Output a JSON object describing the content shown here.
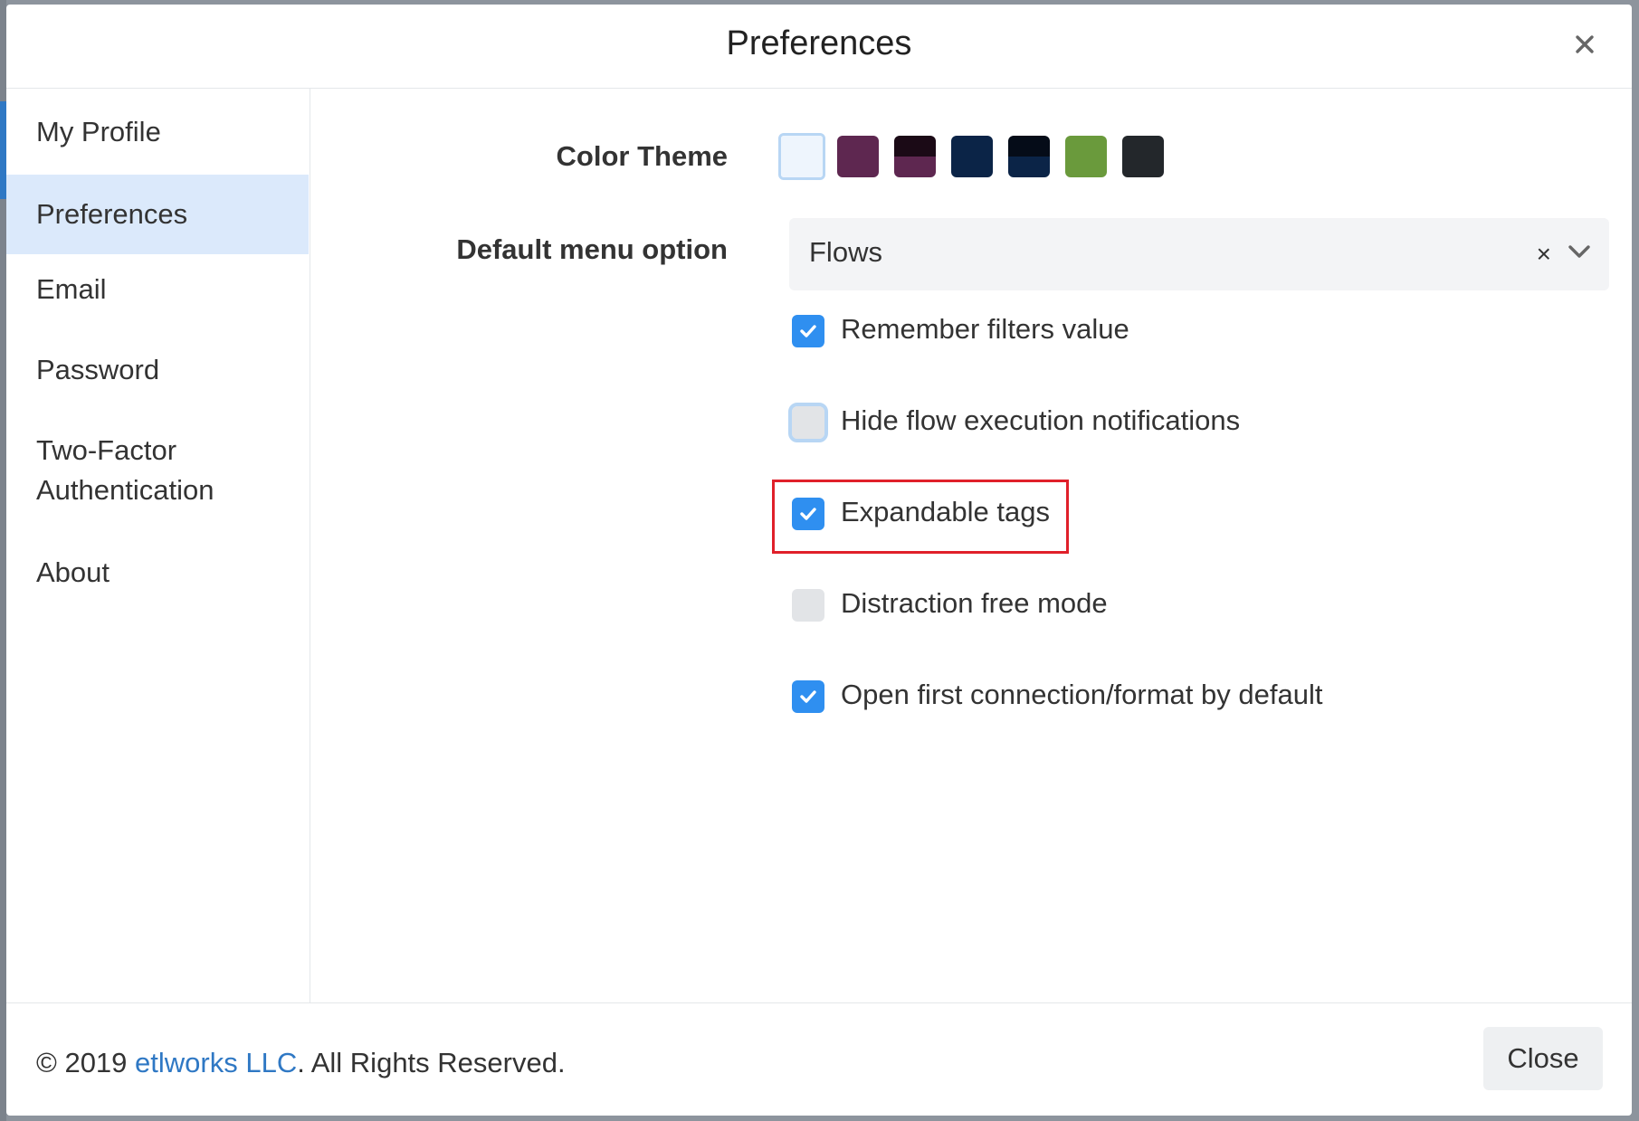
{
  "modal": {
    "title": "Preferences",
    "close_icon": "close-icon"
  },
  "sidebar": {
    "items": [
      {
        "label": "My Profile",
        "active": false
      },
      {
        "label": "Preferences",
        "active": true
      },
      {
        "label": "Email",
        "active": false
      },
      {
        "label": "Password",
        "active": false
      },
      {
        "label": "Two-Factor",
        "label2": "Authentication",
        "active": false
      },
      {
        "label": "About",
        "active": false
      }
    ]
  },
  "form": {
    "color_theme_label": "Color Theme",
    "color_themes": [
      {
        "name": "light",
        "top": "#eef5fd",
        "bottom": "#eef5fd",
        "selected": true
      },
      {
        "name": "plum",
        "top": "#5e2750",
        "bottom": "#5e2750",
        "selected": false
      },
      {
        "name": "plum-dark",
        "top": "#1b0a16",
        "bottom": "#5e2750",
        "selected": false
      },
      {
        "name": "navy",
        "top": "#0b2447",
        "bottom": "#0b2447",
        "selected": false
      },
      {
        "name": "navy-dark",
        "top": "#050c18",
        "bottom": "#0b2447",
        "selected": false
      },
      {
        "name": "green",
        "top": "#6a9a3c",
        "bottom": "#6a9a3c",
        "selected": false
      },
      {
        "name": "charcoal",
        "top": "#23272b",
        "bottom": "#23272b",
        "selected": false
      }
    ],
    "default_menu_label": "Default menu option",
    "default_menu_value": "Flows",
    "clear_symbol": "×",
    "checkboxes": [
      {
        "label": "Remember filters value",
        "checked": true
      },
      {
        "label": "Hide flow execution notifications",
        "checked": false,
        "focused": true
      },
      {
        "label": "Expandable tags",
        "checked": true,
        "highlighted": true
      },
      {
        "label": "Distraction free mode",
        "checked": false
      },
      {
        "label": "Open first connection/format by default",
        "checked": true
      }
    ]
  },
  "footer": {
    "copyright_prefix": "© 2019 ",
    "company_link": "etlworks LLC",
    "copyright_suffix": ". All Rights Reserved.",
    "close_label": "Close"
  },
  "colors": {
    "accent": "#2f8ff0",
    "active_nav_bg": "#dbe9fb",
    "highlight": "#e0202a",
    "link": "#2f78c4"
  }
}
